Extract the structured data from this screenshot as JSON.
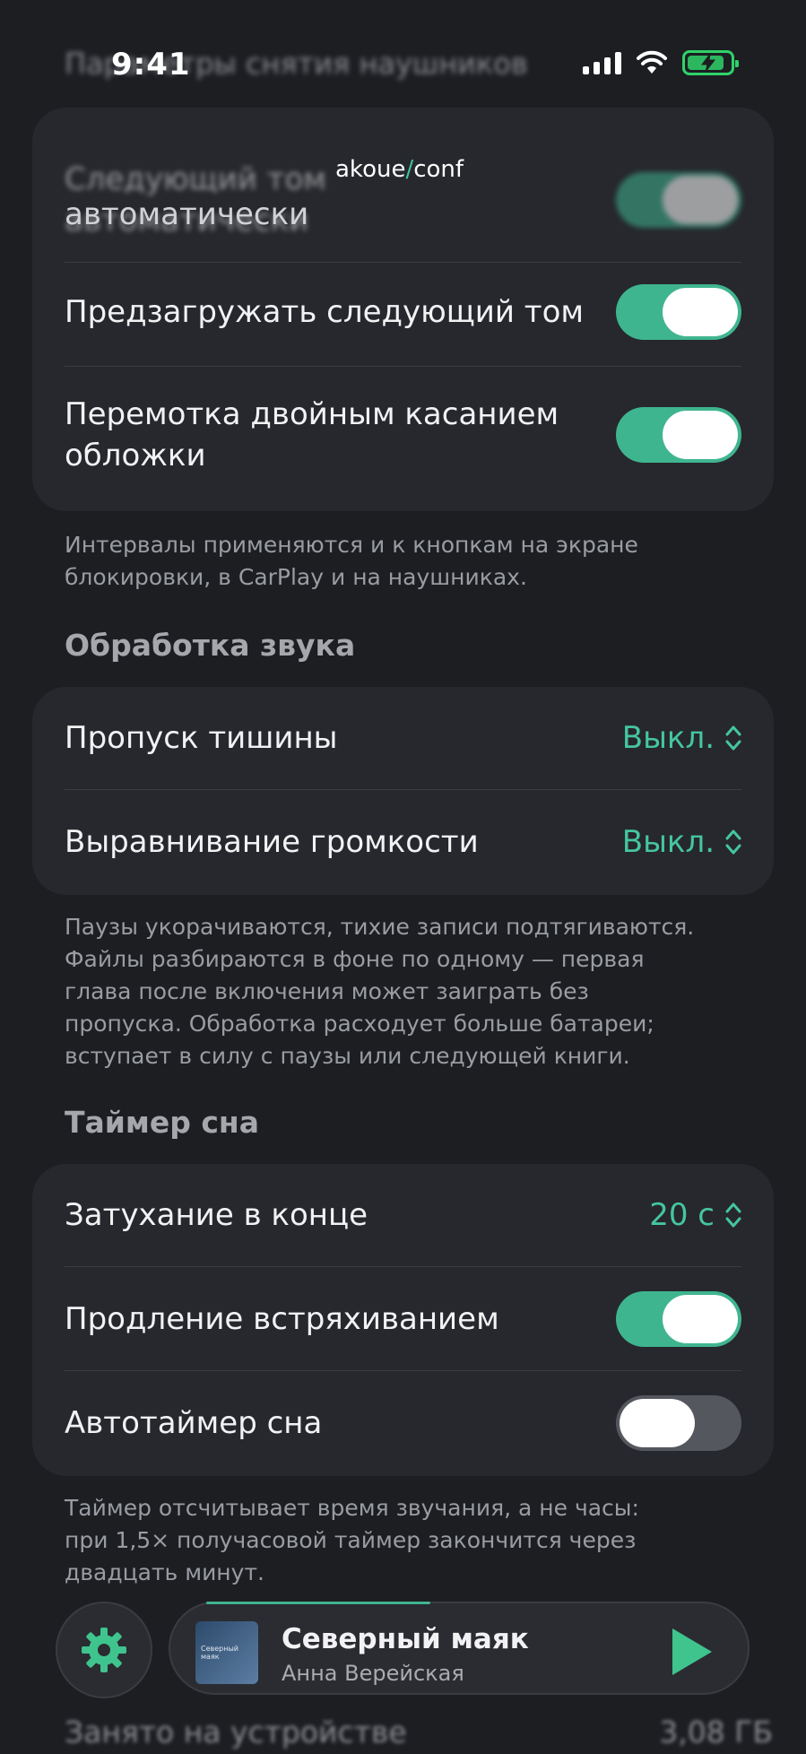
{
  "status_bar": {
    "time": "9:41"
  },
  "header": {
    "blurred_title": "Параметры снятия наушников"
  },
  "watermark": {
    "part1": "akoue",
    "slash": "/",
    "part2": "conf"
  },
  "card1": {
    "rows": [
      {
        "label_line1": "Следующий том",
        "label_line2": "автоматически",
        "toggle": "on"
      },
      {
        "label": "Предзагружать следующий том",
        "toggle": "on"
      },
      {
        "label_line1": "Перемотка двойным касанием",
        "label_line2": "обложки",
        "toggle": "on"
      }
    ]
  },
  "footnote1": {
    "line1": "Интервалы применяются и к кнопкам на экране",
    "line2": "блокировки, в CarPlay и на наушниках."
  },
  "section_audio": {
    "title": "Обработка звука"
  },
  "card2": {
    "rows": [
      {
        "label": "Пропуск тишины",
        "value": "Выкл."
      },
      {
        "label": "Выравнивание громкости",
        "value": "Выкл."
      }
    ]
  },
  "footnote2": {
    "line1": "Паузы укорачиваются, тихие записи подтягиваются.",
    "line2": "Файлы разбираются в фоне по одному — первая",
    "line3": "глава после включения может заиграть без",
    "line4": "пропуска. Обработка расходует больше батареи;",
    "line5": "вступает в силу с паузы или следующей книги."
  },
  "section_sleep": {
    "title": "Таймер сна"
  },
  "card3": {
    "rows": [
      {
        "label": "Затухание в конце",
        "value": "20 с"
      },
      {
        "label": "Продление встряхиванием",
        "toggle": "on"
      },
      {
        "label": "Автотаймер сна",
        "toggle": "off"
      }
    ]
  },
  "footnote3": {
    "line1": "Таймер отсчитывает время звучания, а не часы:",
    "line2": "при 1,5× получасовой таймер закончится через",
    "line3": "двадцать минут."
  },
  "mini_player": {
    "title": "Северный маяк",
    "author": "Анна Верейская",
    "cover_text": "Северный маяк"
  },
  "bottom_row": {
    "label": "Занято на устройстве",
    "value": "3,08 ГБ"
  },
  "colors": {
    "accent": "#3fb58f",
    "background": "#1c1e22",
    "card": "#26282d"
  },
  "icons": [
    "signal-icon",
    "wifi-icon",
    "battery-charging-icon",
    "chevron-updown-icon",
    "gear-icon",
    "play-icon"
  ]
}
